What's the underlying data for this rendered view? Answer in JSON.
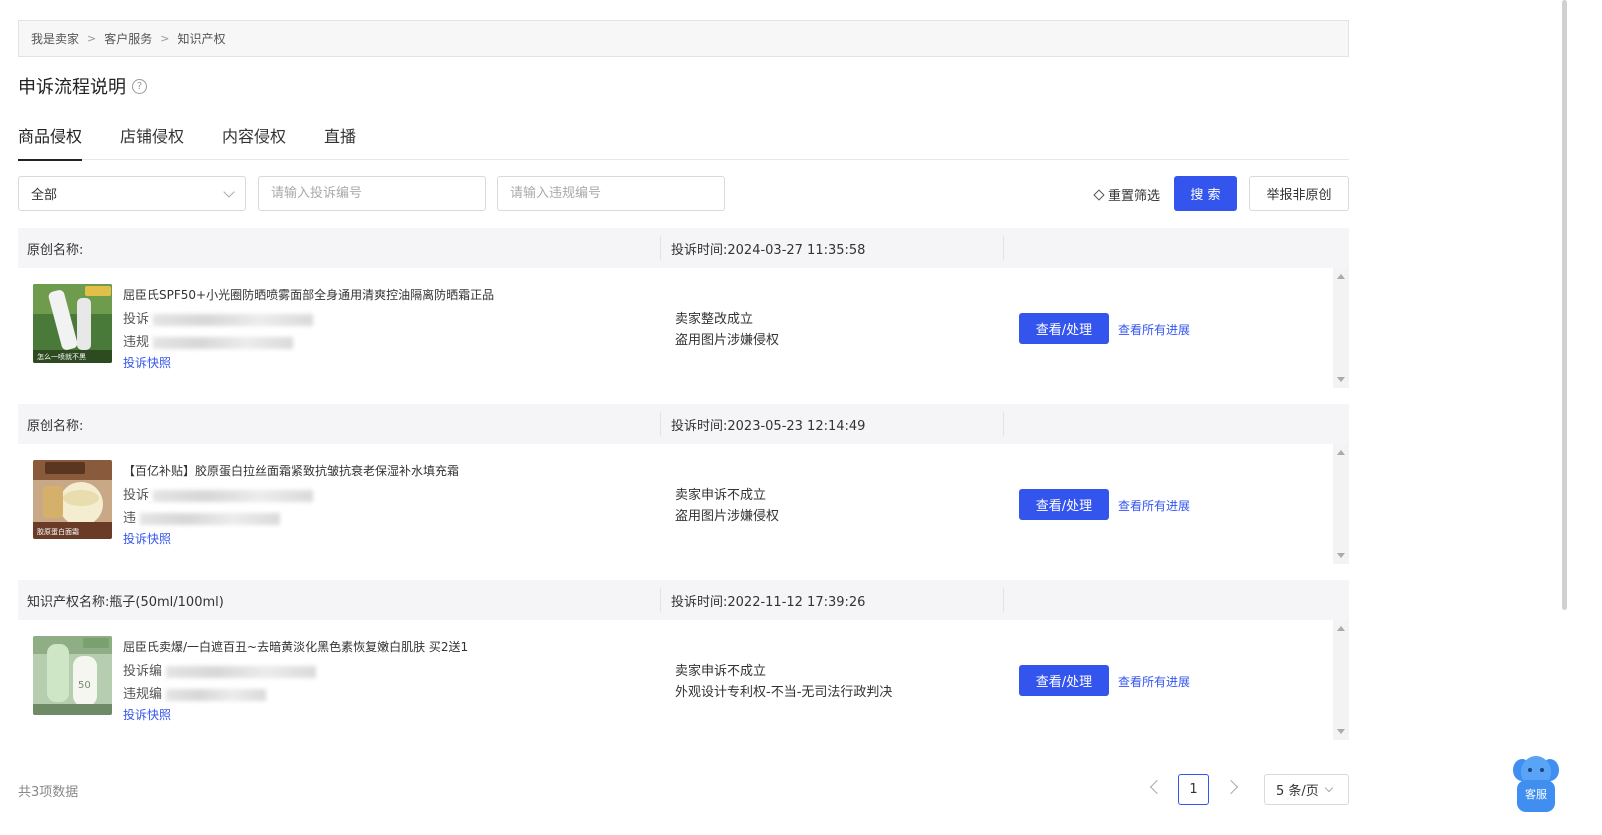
{
  "breadcrumb": [
    "我是卖家",
    "客户服务",
    "知识产权"
  ],
  "breadcrumb_sep": ">",
  "page_title": "申诉流程说明",
  "help_glyph": "?",
  "tabs": [
    {
      "label": "商品侵权",
      "active": true
    },
    {
      "label": "店铺侵权",
      "active": false
    },
    {
      "label": "内容侵权",
      "active": false
    },
    {
      "label": "直播",
      "active": false
    }
  ],
  "filters": {
    "select_value": "全部",
    "complaint_placeholder": "请输入投诉编号",
    "violation_placeholder": "请输入违规编号",
    "reset_label": "重置筛选",
    "search_label": "搜 索",
    "report_label": "举报非原创"
  },
  "records": [
    {
      "original_name": "原创名称:",
      "complaint_time": "投诉时间:2024-03-27 11:35:58",
      "goods_title": "屈臣氏SPF50+小光圈防晒喷雾面部全身通用清爽控油隔离防晒霜正品",
      "complaint_no_label": "投诉",
      "violation_no_label": "违规",
      "snapshot_label": "投诉快照",
      "status_1": "卖家整改成立",
      "status_2": "盗用图片涉嫌侵权",
      "handle_label": "查看/处理",
      "progress_label": "查看所有进展",
      "thumb_caption": "怎么一喷就不黑"
    },
    {
      "original_name": "原创名称:",
      "complaint_time": "投诉时间:2023-05-23 12:14:49",
      "goods_title": "【百亿补贴】胶原蛋白拉丝面霜紧致抗皱抗衰老保湿补水填充霜",
      "complaint_no_label": "投诉",
      "violation_no_label": "违",
      "snapshot_label": "投诉快照",
      "status_1": "卖家申诉不成立",
      "status_2": "盗用图片涉嫌侵权",
      "handle_label": "查看/处理",
      "progress_label": "查看所有进展",
      "thumb_caption": "胶原蛋白面霜"
    },
    {
      "original_name": "知识产权名称:瓶子(50ml/100ml)",
      "complaint_time": "投诉时间:2022-11-12 17:39:26",
      "goods_title": "屈臣氏卖爆/一白遮百丑~去暗黄淡化黑色素恢复嫩白肌肤 买2送1",
      "complaint_no_label": "投诉编",
      "violation_no_label": "违规编",
      "snapshot_label": "投诉快照",
      "status_1": "卖家申诉不成立",
      "status_2": "外观设计专利权-不当-无司法行政判决",
      "handle_label": "查看/处理",
      "progress_label": "查看所有进展",
      "thumb_caption": "50"
    }
  ],
  "pagination": {
    "total": "共3项数据",
    "current_page": "1",
    "page_size": "5 条/页"
  },
  "service_label": "客服",
  "colors": {
    "accent": "#3355ee",
    "header_bg": "#f5f5f7",
    "border": "#d9d9d9"
  }
}
